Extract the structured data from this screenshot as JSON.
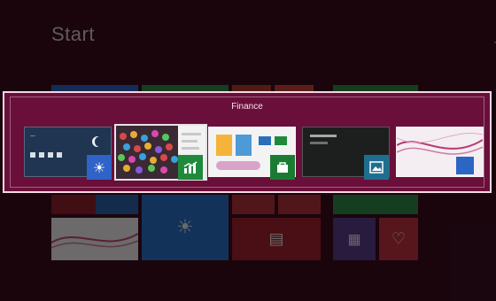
{
  "start_screen": {
    "title": "Start",
    "user_hint": "J"
  },
  "switcher": {
    "label": "Finance",
    "apps": [
      {
        "name": "weather",
        "icon": "weather-icon",
        "badge_color": "#2f63c7"
      },
      {
        "name": "finance",
        "icon": "finance-icon",
        "badge_color": "#1f8a3b"
      },
      {
        "name": "store",
        "icon": "store-icon",
        "badge_color": "#1b7b33"
      },
      {
        "name": "photos",
        "icon": "photos-icon",
        "badge_color": "#1e6f8f"
      },
      {
        "name": "desktop",
        "icon": "desktop-icon",
        "badge_color": "#2b66c4"
      }
    ],
    "accent": "#6a0f3a"
  }
}
